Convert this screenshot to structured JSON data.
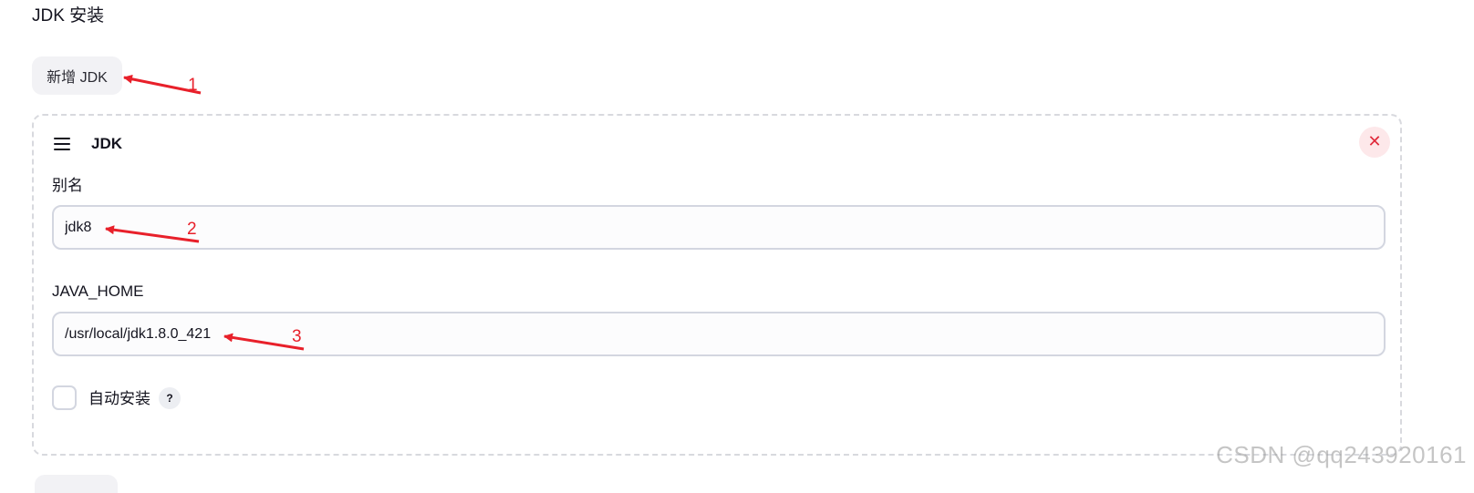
{
  "section": {
    "title": "JDK 安装"
  },
  "add_button": {
    "label": "新增 JDK"
  },
  "jdk_card": {
    "title": "JDK",
    "close_symbol": "✕",
    "alias": {
      "label": "别名",
      "value": "jdk8"
    },
    "java_home": {
      "label": "JAVA_HOME",
      "value": "/usr/local/jdk1.8.0_421"
    },
    "auto_install": {
      "label": "自动安装",
      "checked": false,
      "help_symbol": "?"
    }
  },
  "annotations": {
    "color": "#e8202a",
    "markers": [
      "1",
      "2",
      "3"
    ]
  },
  "colors": {
    "danger": "#e02a3b",
    "danger_bg": "#fde8ea",
    "border": "#d3d6e0"
  },
  "icons": {
    "drag_handle": "hamburger-icon",
    "close": "close-icon",
    "help": "help-icon"
  },
  "watermark": "CSDN @qq243920161"
}
